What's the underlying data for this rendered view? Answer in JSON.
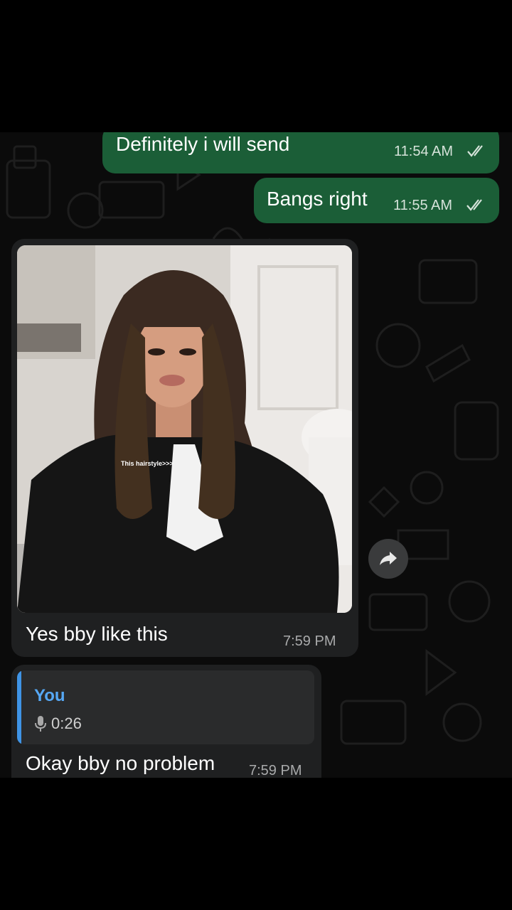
{
  "messages": {
    "out1": {
      "text": "Definitely i will send",
      "time": "11:54 AM"
    },
    "out2": {
      "text": "Bangs right",
      "time": "11:55 AM"
    },
    "in1": {
      "caption": "Yes bby like this",
      "time": "7:59 PM",
      "photo_overlay": "This hairstyle>>>"
    },
    "in2": {
      "quote_author": "You",
      "quote_duration": "0:26",
      "text": "Okay bby no problem",
      "time": "7:59 PM"
    }
  },
  "icons": {
    "read_receipt": "double-check-icon",
    "forward": "forward-arrow-icon",
    "mic": "microphone-icon"
  },
  "colors": {
    "outgoing": "#1b5e37",
    "incoming": "#1f2021",
    "quote_accent": "#3f94e6",
    "chat_bg": "#0b0b0b"
  }
}
